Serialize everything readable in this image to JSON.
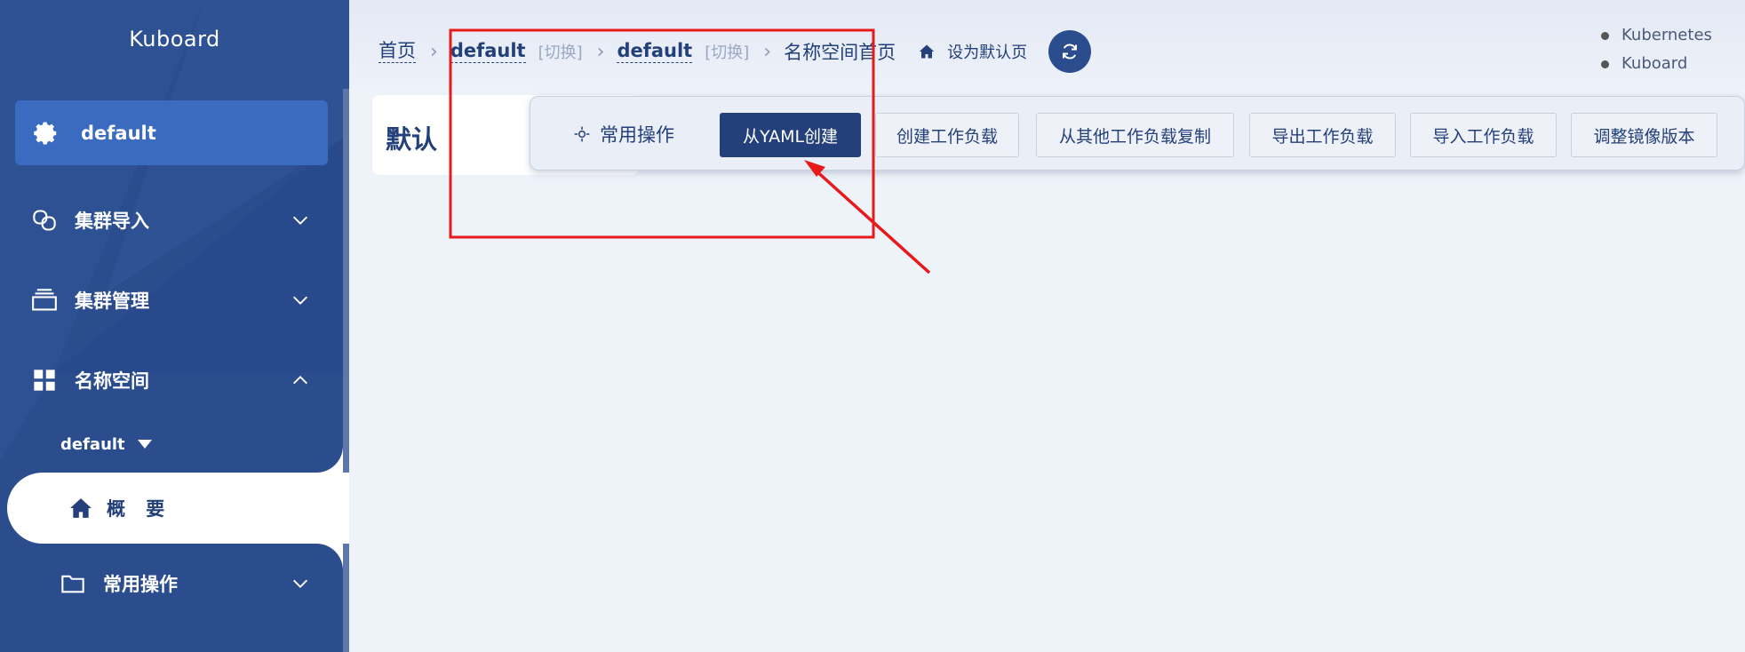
{
  "sidebar": {
    "brand": "Kuboard",
    "cluster": {
      "name": "default",
      "icon": "gear-icon"
    },
    "menu": [
      {
        "label": "集群导入",
        "icon": "link-icon",
        "expanded": false
      },
      {
        "label": "集群管理",
        "icon": "stack-icon",
        "expanded": false
      },
      {
        "label": "名称空间",
        "icon": "grid-icon",
        "expanded": true
      }
    ],
    "namespace_select": "default",
    "active_item": {
      "label": "概 要",
      "icon": "home-icon"
    },
    "sub_menu": {
      "label": "常用操作",
      "icon": "folder-icon",
      "expanded": false
    }
  },
  "header": {
    "breadcrumb": {
      "home": "首页",
      "cluster": "default",
      "cluster_switch": "[切换]",
      "namespace": "default",
      "namespace_switch": "[切换]",
      "current": "名称空间首页"
    },
    "set_default_label": "设为默认页",
    "versions": [
      "Kubernetes",
      "Kuboard"
    ]
  },
  "main": {
    "title": "默认",
    "toolbar": {
      "label": "常用操作",
      "buttons": [
        "从YAML创建",
        "创建工作负载",
        "从其他工作负载复制",
        "导出工作负载",
        "导入工作负载",
        "调整镜像版本"
      ]
    }
  },
  "colors": {
    "sidebar_bg": "#2b4d8e",
    "accent": "#23407a",
    "cluster_card": "#3b6bc1",
    "annotation_red": "#e8191b"
  }
}
